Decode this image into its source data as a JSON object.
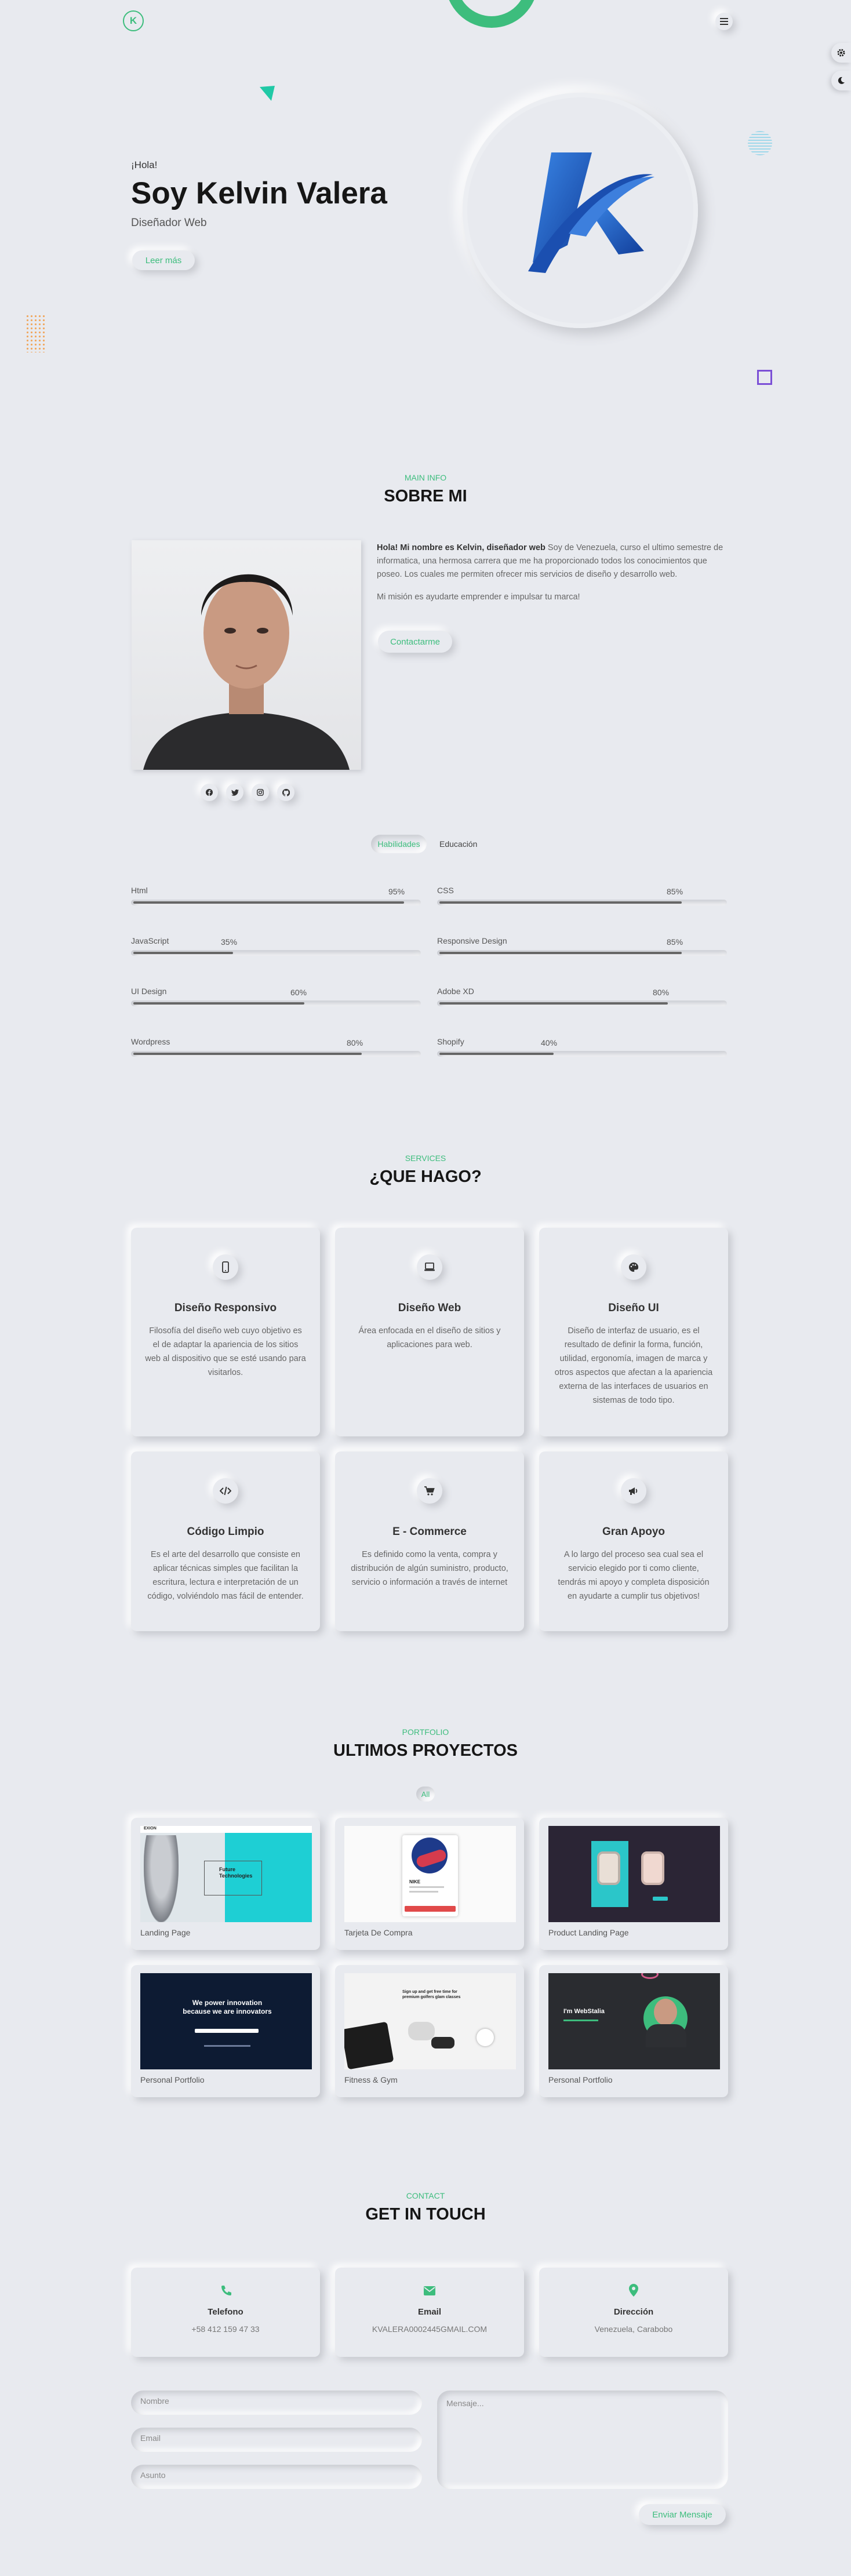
{
  "nav": {
    "logo_letter": "K",
    "menu_icon": "hamburger-icon",
    "settings_icon": "gear-icon",
    "theme_icon": "moon-icon"
  },
  "hero": {
    "greeting": "¡Hola!",
    "name": "Soy Kelvin Valera",
    "role": "Diseñador Web",
    "button": "Leer más"
  },
  "about": {
    "subtitle": "MAIN INFO",
    "title": "SOBRE MI",
    "bold_intro": "Hola! Mi nombre es Kelvin, diseñador web",
    "paragraph1": " Soy de Venezuela, curso el ultimo semestre de informatica, una hermosa carrera que me ha proporcionado todos los conocimientos que poseo. Los cuales me permiten ofrecer mis servicios de diseño y desarrollo web.",
    "paragraph2": "Mi misión es ayudarte emprender e impulsar tu marca!",
    "button": "Contactarme",
    "social_icons": [
      "facebook-icon",
      "twitter-icon",
      "instagram-icon",
      "github-icon"
    ]
  },
  "tabs": {
    "skills": "Habilidades",
    "education": "Educación"
  },
  "skills": [
    {
      "name": "Html",
      "percent": "95%",
      "value": 95
    },
    {
      "name": "CSS",
      "percent": "85%",
      "value": 85
    },
    {
      "name": "JavaScript",
      "percent": "35%",
      "value": 35
    },
    {
      "name": "Responsive Design",
      "percent": "85%",
      "value": 85
    },
    {
      "name": "UI Design",
      "percent": "60%",
      "value": 60
    },
    {
      "name": "Adobe XD",
      "percent": "80%",
      "value": 80
    },
    {
      "name": "Wordpress",
      "percent": "80%",
      "value": 80
    },
    {
      "name": "Shopify",
      "percent": "40%",
      "value": 40
    }
  ],
  "services": {
    "subtitle": "SERVICES",
    "title": "¿QUE HAGO?",
    "items": [
      {
        "icon": "mobile-icon",
        "title": "Diseño Responsivo",
        "text": "Filosofía del diseño web cuyo objetivo es el de adaptar la apariencia de los sitios web al dispositivo que se esté usando para visitarlos."
      },
      {
        "icon": "laptop-icon",
        "title": "Diseño Web",
        "text": "Área enfocada en el diseño de sitios y aplicaciones para web."
      },
      {
        "icon": "palette-icon",
        "title": "Diseño UI",
        "text": "Diseño de interfaz de usuario, es el resultado de definir la forma, función, utilidad, ergonomía, imagen de marca y otros aspectos que afectan a la apariencia externa de las interfaces de usuarios en sistemas de todo tipo."
      },
      {
        "icon": "code-icon",
        "title": "Código Limpio",
        "text": "Es el arte del desarrollo que consiste en aplicar técnicas simples que facilitan la escritura, lectura e interpretación de un código, volviéndolo mas fácil de entender."
      },
      {
        "icon": "cart-icon",
        "title": "E - Commerce",
        "text": "Es definido como la venta, compra y distribución de algún suministro, producto, servicio o información a través de internet"
      },
      {
        "icon": "megaphone-icon",
        "title": "Gran Apoyo",
        "text": "A lo largo del proceso sea cual sea el servicio elegido por ti como cliente, tendrás mi apoyo y completa disposición en ayudarte a cumplir tus objetivos!"
      }
    ]
  },
  "portfolio": {
    "subtitle": "PORTFOLIO",
    "title": "ULTIMOS PROYECTOS",
    "filter": "All",
    "items": [
      {
        "caption": "Landing Page",
        "thumb_heading": "Future Technologies",
        "thumb_brand": "EXION"
      },
      {
        "caption": "Tarjeta De Compra",
        "thumb_heading": "NIKE"
      },
      {
        "caption": "Product Landing Page"
      },
      {
        "caption": "Personal Portfolio",
        "thumb_heading": "We power innovation because we are innovators"
      },
      {
        "caption": "Fitness & Gym",
        "thumb_heading": "Sign up and get free time for premium golfers glam classes"
      },
      {
        "caption": "Personal Portfolio",
        "thumb_heading": "I'm WebStalia"
      }
    ]
  },
  "contact": {
    "subtitle": "CONTACT",
    "title": "GET IN TOUCH",
    "items": [
      {
        "icon": "phone-icon",
        "label": "Telefono",
        "value": "+58 412 159 47 33"
      },
      {
        "icon": "envelope-icon",
        "label": "Email",
        "value": "KVALERA0002445GMAIL.COM"
      },
      {
        "icon": "map-pin-icon",
        "label": "Dirección",
        "value": "Venezuela, Carabobo"
      }
    ],
    "form": {
      "name": "Nombre",
      "email": "Email",
      "subject": "Asunto",
      "message": "Mensaje...",
      "submit": "Enviar Mensaje"
    }
  },
  "colors": {
    "accent": "#3dbd7d",
    "background": "#e8eaef",
    "logo_blue": "#1f5fbf",
    "decor_purple": "#7b4fd6",
    "decor_orange": "#f0a860",
    "decor_teal": "#20c9a6",
    "decor_cyan": "#9fd8ea"
  }
}
